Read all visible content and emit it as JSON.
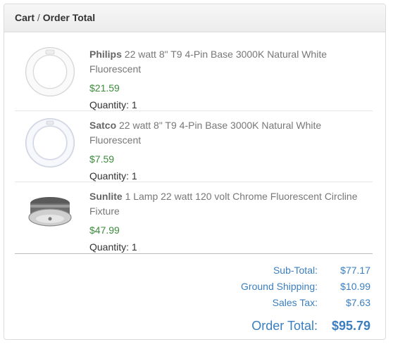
{
  "header": {
    "cart": "Cart",
    "separator": "/",
    "title": "Order Total"
  },
  "items": [
    {
      "brand": "Philips",
      "description": "22 watt 8\" T9 4-Pin Base 3000K Natural White Fluorescent",
      "price": "$21.59",
      "quantity": "Quantity: 1",
      "icon": "circline-lamp-icon"
    },
    {
      "brand": "Satco",
      "description": "22 watt 8\" T9 4-Pin Base 3000K Natural White Fluorescent",
      "price": "$7.59",
      "quantity": "Quantity: 1",
      "icon": "circline-lamp-icon"
    },
    {
      "brand": "Sunlite",
      "description": "1 Lamp 22 watt 120 volt Chrome Fluorescent Circline Fixture",
      "price": "$47.99",
      "quantity": "Quantity: 1",
      "icon": "ceiling-fixture-icon"
    }
  ],
  "totals": {
    "subtotal_label": "Sub-Total:",
    "subtotal_value": "$77.17",
    "shipping_label": "Ground Shipping:",
    "shipping_value": "$10.99",
    "tax_label": "Sales Tax:",
    "tax_value": "$7.63",
    "order_label": "Order Total:",
    "order_value": "$95.79"
  },
  "colors": {
    "price": "#3c8b3c",
    "totals": "#3a7ebf"
  }
}
